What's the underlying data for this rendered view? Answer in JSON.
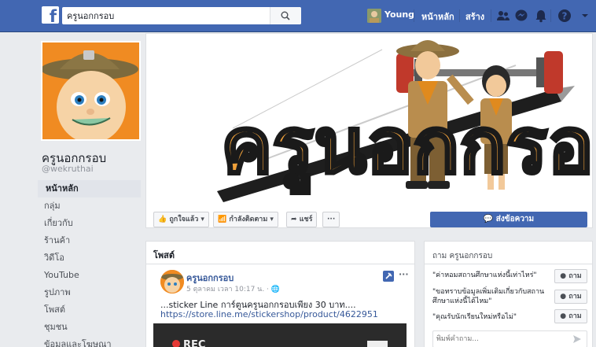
{
  "topbar": {
    "logo": "f",
    "search_value": "ครูนอกกรอบ",
    "user_name": "Young",
    "home_label": "หน้าหลัก",
    "create_label": "สร้าง"
  },
  "page": {
    "name": "ครูนอกกรอบ",
    "handle": "@wekruthai"
  },
  "left_menu": [
    {
      "label": "หน้าหลัก",
      "active": true
    },
    {
      "label": "กลุ่ม"
    },
    {
      "label": "เกี่ยวกับ"
    },
    {
      "label": "ร้านค้า"
    },
    {
      "label": "วิดีโอ"
    },
    {
      "label": "YouTube"
    },
    {
      "label": "รูปภาพ"
    },
    {
      "label": "โพสต์"
    },
    {
      "label": "ชุมชน"
    },
    {
      "label": "ข้อมูลและโฆษณา"
    }
  ],
  "cover": {
    "title_text": "ครูนอกกรอบ"
  },
  "actions": {
    "liked_label": "ถูกใจแล้ว",
    "following_label": "กำลังติดตาม",
    "share_label": "แชร์",
    "more_label": "···",
    "send_message_label": "ส่งข้อความ"
  },
  "posts": {
    "title": "โพสต์",
    "author": "ครูนอกกรอบ",
    "date": "5 ตุลาคม เวลา 10:17 น. · ",
    "text": "...sticker Line การ์ตูนครูนอกกรอบเพียง 30 บาท....",
    "link": "https://store.line.me/stickershop/product/4622951",
    "more_label": "···",
    "image_text": "REC"
  },
  "ask": {
    "title": "ถาม ครูนอกกรอบ",
    "questions": [
      {
        "text": "\"ค่าหอมสถานศึกษาแห่งนี้เท่าไหร่\"",
        "button": "ถาม"
      },
      {
        "text": "\"ขอทราบข้อมูลเพิ่มเติมเกี่ยวกับสถานศึกษาแห่งนี้ได้ไหม\"",
        "button": "ถาม"
      },
      {
        "text": "\"คุณรับนักเรียนใหม่หรือไม่\"",
        "button": "ถาม"
      }
    ],
    "input_placeholder": "พิมพ์คำถาม..."
  },
  "colors": {
    "fb_blue": "#4267b2",
    "page_bg": "#e9ebee",
    "link_blue": "#365899",
    "cover_orange": "#f08b22"
  }
}
